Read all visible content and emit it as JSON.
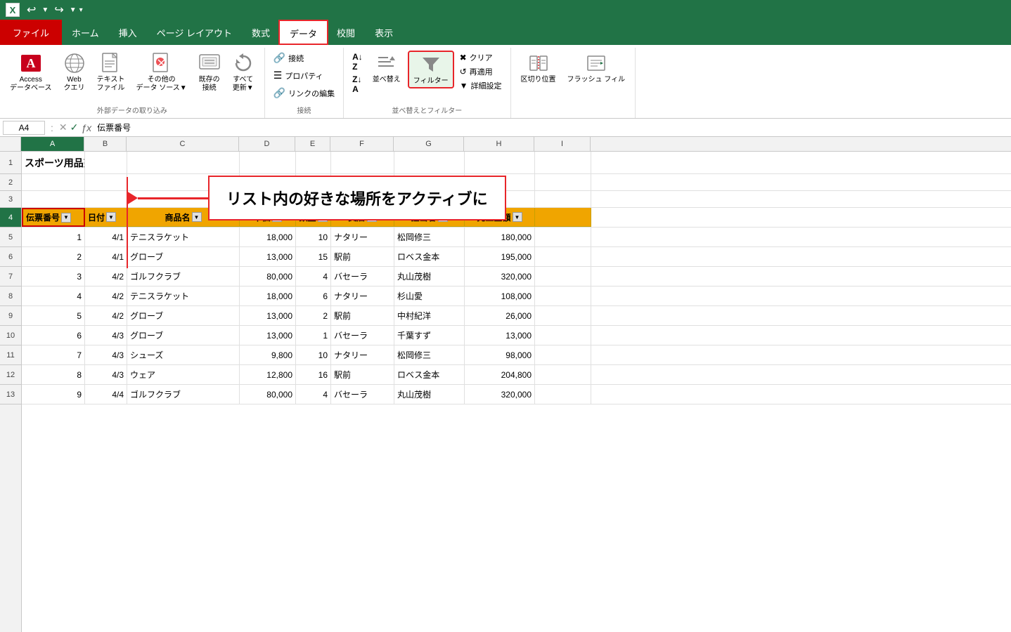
{
  "titlebar": {
    "excel_label": "X",
    "undo_label": "↩",
    "redo_label": "↪"
  },
  "ribbon": {
    "tabs": [
      {
        "id": "file",
        "label": "ファイル",
        "type": "file"
      },
      {
        "id": "home",
        "label": "ホーム",
        "type": "normal"
      },
      {
        "id": "insert",
        "label": "挿入",
        "type": "normal"
      },
      {
        "id": "page_layout",
        "label": "ページ レイアウト",
        "type": "normal"
      },
      {
        "id": "formulas",
        "label": "数式",
        "type": "normal"
      },
      {
        "id": "data",
        "label": "データ",
        "type": "active"
      },
      {
        "id": "review",
        "label": "校閲",
        "type": "normal"
      },
      {
        "id": "view",
        "label": "表示",
        "type": "normal"
      }
    ],
    "groups": {
      "external_data": {
        "label": "外部データの取り込み",
        "buttons": [
          {
            "id": "access",
            "icon": "🅰",
            "label": "Access\nデータベース"
          },
          {
            "id": "web",
            "icon": "🌐",
            "label": "Web\nクエリ"
          },
          {
            "id": "text",
            "icon": "📄",
            "label": "テキスト\nファイル"
          },
          {
            "id": "other",
            "icon": "◆",
            "label": "その他の\nデータ ソース▼"
          },
          {
            "id": "existing",
            "icon": "📋",
            "label": "既存の\n接続"
          },
          {
            "id": "refresh_all",
            "icon": "🔄",
            "label": "すべて\n更新▼"
          }
        ]
      },
      "connections": {
        "label": "接続",
        "items": [
          {
            "id": "connect",
            "icon": "🔗",
            "label": "接続"
          },
          {
            "id": "props",
            "icon": "≡",
            "label": "プロパティ"
          },
          {
            "id": "edit_links",
            "icon": "🔗",
            "label": "リンクの編集"
          }
        ]
      },
      "sort_filter": {
        "label": "並べ替えとフィルター",
        "items": [
          {
            "id": "sort_az",
            "label": "A↓Z"
          },
          {
            "id": "sort_za",
            "label": "Z↓A"
          },
          {
            "id": "sort_custom",
            "label": "並べ替え"
          },
          {
            "id": "filter",
            "icon": "▽",
            "label": "フィルター",
            "highlighted": true
          },
          {
            "id": "clear",
            "label": "クリア"
          },
          {
            "id": "reapply",
            "label": "再適用"
          },
          {
            "id": "advanced",
            "label": "詳細設定"
          }
        ]
      },
      "data_tools": {
        "label": "",
        "items": [
          {
            "id": "text_to_col",
            "label": "区切り位置"
          },
          {
            "id": "flash_fill",
            "label": "フラッシュ\nフィル"
          }
        ]
      }
    }
  },
  "formula_bar": {
    "cell_ref": "A4",
    "formula_text": "伝票番号"
  },
  "spreadsheet": {
    "col_headers": [
      "A",
      "B",
      "C",
      "D",
      "E",
      "F",
      "G",
      "H",
      "I"
    ],
    "row1": {
      "cells": [
        "スポーツ用品売上表",
        "",
        "",
        "",
        "",
        "",
        "",
        "",
        ""
      ]
    },
    "row2": {
      "cells": [
        "",
        "",
        "",
        "",
        "",
        "",
        "",
        "",
        ""
      ]
    },
    "row3": {
      "cells": [
        "",
        "",
        "",
        "",
        "",
        "",
        "",
        "",
        ""
      ]
    },
    "header_row": {
      "row_num": 4,
      "cells": [
        "伝票番号",
        "日付",
        "商品名",
        "単価",
        "数量",
        "支店",
        "担当者",
        "売上金額",
        ""
      ]
    },
    "data_rows": [
      {
        "row": 5,
        "cells": [
          "1",
          "4/1",
          "テニスラケット",
          "18,000",
          "10",
          "ナタリー",
          "松岡修三",
          "180,000",
          ""
        ]
      },
      {
        "row": 6,
        "cells": [
          "2",
          "4/1",
          "グローブ",
          "13,000",
          "15",
          "駅前",
          "ロベス金本",
          "195,000",
          ""
        ]
      },
      {
        "row": 7,
        "cells": [
          "3",
          "4/2",
          "ゴルフクラブ",
          "80,000",
          "4",
          "バセーラ",
          "丸山茂樹",
          "320,000",
          ""
        ]
      },
      {
        "row": 8,
        "cells": [
          "4",
          "4/2",
          "テニスラケット",
          "18,000",
          "6",
          "ナタリー",
          "杉山愛",
          "108,000",
          ""
        ]
      },
      {
        "row": 9,
        "cells": [
          "5",
          "4/2",
          "グローブ",
          "13,000",
          "2",
          "駅前",
          "中村紀洋",
          "26,000",
          ""
        ]
      },
      {
        "row": 10,
        "cells": [
          "6",
          "4/3",
          "グローブ",
          "13,000",
          "1",
          "バセーラ",
          "千葉すず",
          "13,000",
          ""
        ]
      },
      {
        "row": 11,
        "cells": [
          "7",
          "4/3",
          "シューズ",
          "9,800",
          "10",
          "ナタリー",
          "松岡修三",
          "98,000",
          ""
        ]
      },
      {
        "row": 12,
        "cells": [
          "8",
          "4/3",
          "ウェア",
          "12,800",
          "16",
          "駅前",
          "ロベス金本",
          "204,800",
          ""
        ]
      },
      {
        "row": 13,
        "cells": [
          "9",
          "4/4",
          "ゴルフクラブ",
          "80,000",
          "4",
          "バセーラ",
          "丸山茂樹",
          "320,000",
          ""
        ]
      }
    ],
    "callout_text": "リスト内の好きな場所をアクティブに"
  },
  "colors": {
    "header_bg": "#f0a500",
    "filter_highlight": "#e8252a",
    "excel_green": "#217346",
    "file_red": "#c00000"
  }
}
